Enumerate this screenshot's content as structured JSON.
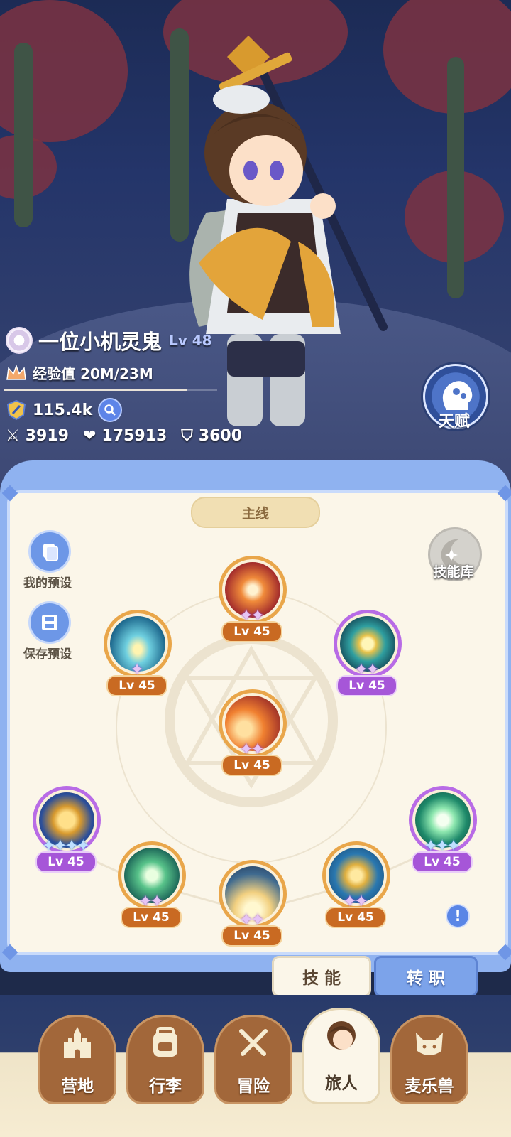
{
  "hero": {
    "name": "一位小机灵鬼",
    "level": "Lv 48",
    "exp": "经验值 20M/23M",
    "exp_progress": 0.87,
    "power": "115.4k",
    "attack": "3919",
    "health": "175913",
    "defense": "3600"
  },
  "talent": {
    "label": "天赋"
  },
  "panel": {
    "tab_title": "主线",
    "my_presets": "我的预设",
    "save_preset": "保存预设",
    "skill_library": "技能库",
    "info": "!"
  },
  "skills": [
    {
      "level": "Lv 45",
      "stars": "✦✦",
      "tier": "orange",
      "icon": "red-burst-skill"
    },
    {
      "level": "Lv 45",
      "stars": "✦",
      "tier": "orange",
      "icon": "water-ripple-skill"
    },
    {
      "level": "Lv 45",
      "stars": "✦✦",
      "tier": "purple",
      "icon": "golden-orb-skill"
    },
    {
      "level": "Lv 45",
      "stars": "✦✦",
      "tier": "orange",
      "icon": "flame-slash-skill"
    },
    {
      "level": "Lv 45",
      "stars": "✦✦✦✦",
      "tier": "purple",
      "icon": "gold-wave-skill"
    },
    {
      "level": "Lv 45",
      "stars": "✦✦",
      "tier": "orange",
      "icon": "green-cross-skill"
    },
    {
      "level": "Lv 45",
      "stars": "✦✦",
      "tier": "orange",
      "icon": "light-rays-skill"
    },
    {
      "level": "Lv 45",
      "stars": "✦✦",
      "tier": "orange",
      "icon": "star-wand-skill"
    },
    {
      "level": "Lv 45",
      "stars": "✦✦✦",
      "tier": "purple",
      "icon": "green-sparkle-skill"
    }
  ],
  "bottom_tabs": {
    "skills": "技 能",
    "job_change": "转 职"
  },
  "nav": [
    {
      "label": "营地",
      "icon": "castle-icon"
    },
    {
      "label": "行李",
      "icon": "backpack-icon"
    },
    {
      "label": "冒险",
      "icon": "crossed-swords-icon"
    },
    {
      "label": "旅人",
      "icon": "hero-portrait-icon",
      "active": true
    },
    {
      "label": "麦乐兽",
      "icon": "cat-pet-icon"
    }
  ],
  "colors": {
    "panel_bg": "#fbf6e9",
    "accent_blue": "#6d97e7",
    "orange_tier": "#c96a22",
    "purple_tier": "#a656d8"
  }
}
